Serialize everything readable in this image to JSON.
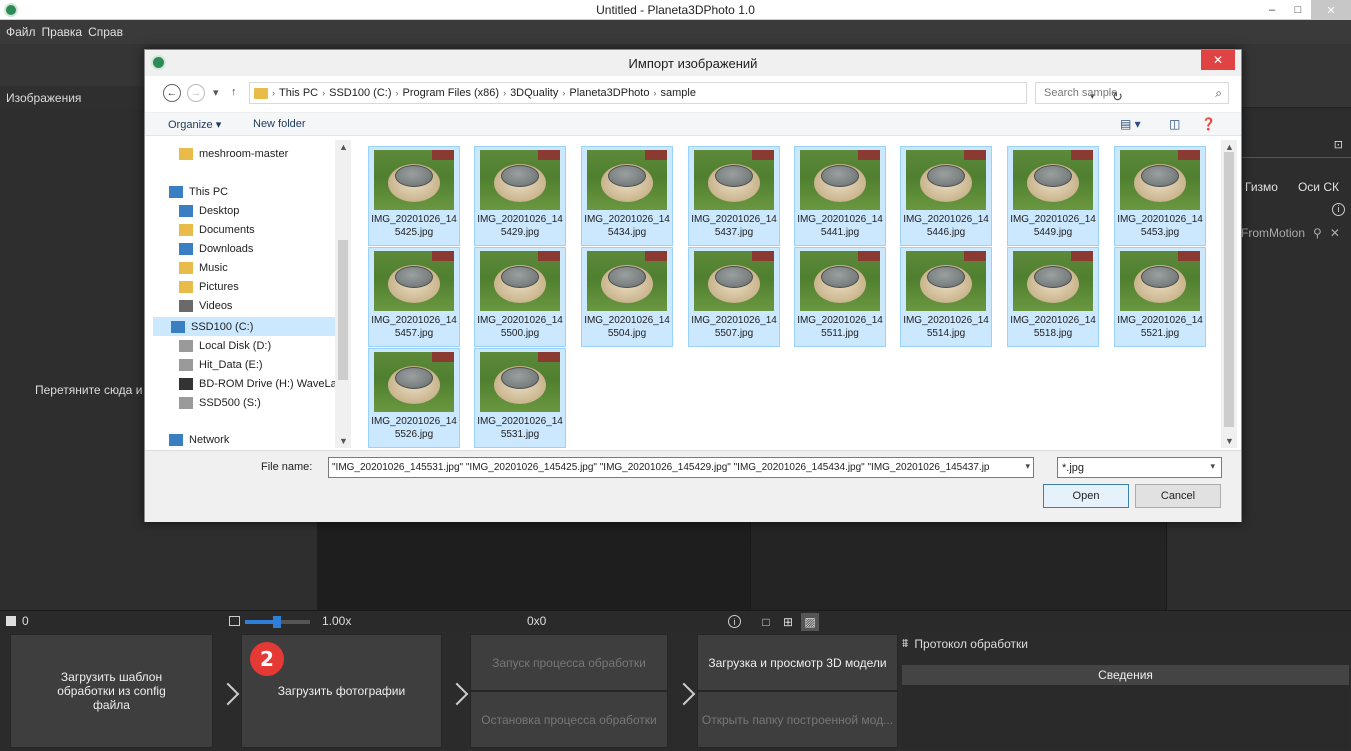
{
  "main_window": {
    "title": "Untitled - Planeta3DPhoto 1.0",
    "minimize": "–",
    "maximize": "□",
    "close": "✕"
  },
  "menu": [
    "Файл",
    "Правка",
    "Справ"
  ],
  "left_panel": {
    "header": "Изображения",
    "drop_hint": "Перетяните сюда и"
  },
  "right_panel": {
    "tabs": [
      "Гизмо",
      "Оси СК"
    ],
    "sfm_label": "FromMotion",
    "tool_icon": "⊡",
    "info": "i",
    "close": "✕"
  },
  "statusbar": {
    "image_count": "0",
    "zoom": "1.00x",
    "size": "0x0",
    "info": "i",
    "view_modes": [
      "□",
      "⊞",
      "▨"
    ]
  },
  "workflow": {
    "load_template": "Загрузить шаблон обработки из config файла",
    "load_photos": "Загрузить фотографии",
    "start_processing": "Запуск процесса обработки",
    "stop_processing": "Остановка процесса обработки",
    "load_view_3d": "Загрузка и просмотр 3D модели",
    "open_folder": "Открыть папку построенной мод...",
    "step_badge": "2",
    "protocol_title": "Протокол обработки",
    "protocol_icon": "⩩",
    "details_header": "Сведения"
  },
  "dialog": {
    "title": "Импорт изображений",
    "close": "✕",
    "back": "←",
    "forward": "→",
    "recent": "▾",
    "up": "↑",
    "breadcrumb": [
      "This PC",
      "SSD100 (C:)",
      "Program Files (x86)",
      "3DQuality",
      "Planeta3DPhoto",
      "sample"
    ],
    "search_placeholder": "Search sample",
    "refresh": "↻",
    "search_icon": "⌕",
    "organize": "Organize ▾",
    "new_folder": "New folder",
    "view_icons": [
      "▤ ▾",
      "◫",
      "❓"
    ],
    "nav_items": [
      {
        "label": "meshroom-master",
        "icon": "folder-icon",
        "color": "#e9bb4a"
      },
      {
        "label": "This PC",
        "icon": "computer-icon",
        "color": "#3a7fc1"
      },
      {
        "label": "Desktop",
        "icon": "desktop-icon",
        "color": "#3a7fc1"
      },
      {
        "label": "Documents",
        "icon": "documents-icon",
        "color": "#e9bb4a"
      },
      {
        "label": "Downloads",
        "icon": "downloads-icon",
        "color": "#3a7fc1"
      },
      {
        "label": "Music",
        "icon": "music-icon",
        "color": "#e9bb4a"
      },
      {
        "label": "Pictures",
        "icon": "pictures-icon",
        "color": "#e9bb4a"
      },
      {
        "label": "Videos",
        "icon": "videos-icon",
        "color": "#6a6a6a"
      },
      {
        "label": "SSD100 (C:)",
        "icon": "drive-icon",
        "color": "#3a7fc1"
      },
      {
        "label": "Local Disk (D:)",
        "icon": "drive-icon",
        "color": "#9a9a9a"
      },
      {
        "label": "Hit_Data (E:)",
        "icon": "drive-icon",
        "color": "#9a9a9a"
      },
      {
        "label": "BD-ROM Drive (H:) WaveLal",
        "icon": "disc-icon",
        "color": "#333333"
      },
      {
        "label": "SSD500 (S:)",
        "icon": "drive-icon",
        "color": "#9a9a9a"
      },
      {
        "label": "Network",
        "icon": "network-icon",
        "color": "#3a7fc1"
      }
    ],
    "files": [
      "IMG_20201026_14\n5425.jpg",
      "IMG_20201026_14\n5429.jpg",
      "IMG_20201026_14\n5434.jpg",
      "IMG_20201026_14\n5437.jpg",
      "IMG_20201026_14\n5441.jpg",
      "IMG_20201026_14\n5446.jpg",
      "IMG_20201026_14\n5449.jpg",
      "IMG_20201026_14\n5453.jpg",
      "IMG_20201026_14\n5457.jpg",
      "IMG_20201026_14\n5500.jpg",
      "IMG_20201026_14\n5504.jpg",
      "IMG_20201026_14\n5507.jpg",
      "IMG_20201026_14\n5511.jpg",
      "IMG_20201026_14\n5514.jpg",
      "IMG_20201026_14\n5518.jpg",
      "IMG_20201026_14\n5521.jpg",
      "IMG_20201026_14\n5526.jpg",
      "IMG_20201026_14\n5531.jpg"
    ],
    "file_name_label": "File name:",
    "file_name_value": "\"IMG_20201026_145531.jpg\" \"IMG_20201026_145425.jpg\" \"IMG_20201026_145429.jpg\" \"IMG_20201026_145434.jpg\" \"IMG_20201026_145437.jp",
    "file_type": "*.jpg",
    "open": "Open",
    "cancel": "Cancel"
  }
}
